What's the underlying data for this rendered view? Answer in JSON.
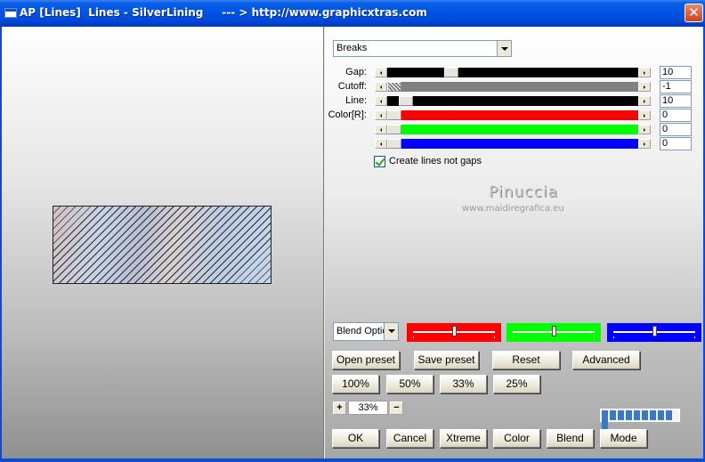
{
  "window": {
    "title": "AP [Lines]  Lines - SilverLining     --- > http://www.graphicxtras.com",
    "close_icon": "close-icon"
  },
  "controls": {
    "mode_select": "Breaks",
    "sliders": [
      {
        "label": "Gap:",
        "value": "10",
        "track_color": "#000000",
        "level": 0.24
      },
      {
        "label": "Cutoff:",
        "value": "-1",
        "track_color": "#808080",
        "level": 0.0
      },
      {
        "label": "Line:",
        "value": "10",
        "track_color": "#000000",
        "level": 0.05
      },
      {
        "label": "Color[R]:",
        "value": "0",
        "track_color": "#ff0000",
        "level": 0.0
      },
      {
        "label": "",
        "value": "0",
        "track_color": "#00ff00",
        "level": 0.0
      },
      {
        "label": "",
        "value": "0",
        "track_color": "#0000ff",
        "level": 0.0
      }
    ],
    "checkbox_label": "Create lines not gaps",
    "checkbox_checked": true
  },
  "watermark": {
    "name": "Pinuccia",
    "url": "www.maidiregrafica.eu"
  },
  "blend": {
    "select_value": "Blend Optio",
    "color_sliders": [
      {
        "color": "#ff0000",
        "level": 0.5
      },
      {
        "color": "#00ff00",
        "level": 0.5
      },
      {
        "color": "#0000ff",
        "level": 0.5
      }
    ]
  },
  "presets": {
    "open": "Open preset",
    "save": "Save preset",
    "reset": "Reset",
    "advanced": "Advanced"
  },
  "zoom_buttons": [
    "100%",
    "50%",
    "33%",
    "25%"
  ],
  "zoom": {
    "value": "33%",
    "plus": "+",
    "minus": "−"
  },
  "progress": {
    "segments": 10
  },
  "bottom_buttons": {
    "ok": "OK",
    "cancel": "Cancel",
    "xtreme": "Xtreme",
    "color": "Color",
    "blend": "Blend",
    "mode": "Mode"
  }
}
